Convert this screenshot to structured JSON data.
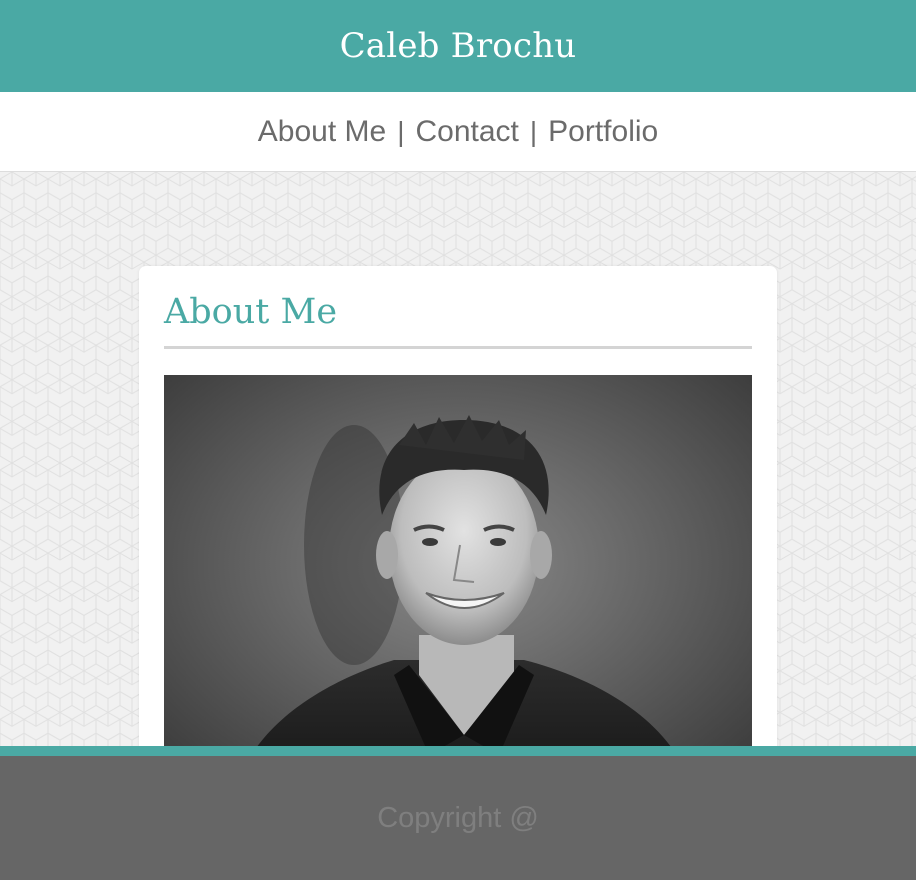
{
  "header": {
    "title": "Caleb Brochu"
  },
  "nav": {
    "items": [
      {
        "label": "About Me"
      },
      {
        "label": "Contact"
      },
      {
        "label": "Portfolio"
      }
    ],
    "separator": "|"
  },
  "main": {
    "section_title": "About Me",
    "photo": {
      "subject": "profile-photo",
      "style": "black-and-white portrait"
    }
  },
  "footer": {
    "copyright": "Copyright @"
  },
  "colors": {
    "accent": "#4aa9a4",
    "footer_bg": "#666666",
    "nav_text": "#6b6b6b"
  }
}
